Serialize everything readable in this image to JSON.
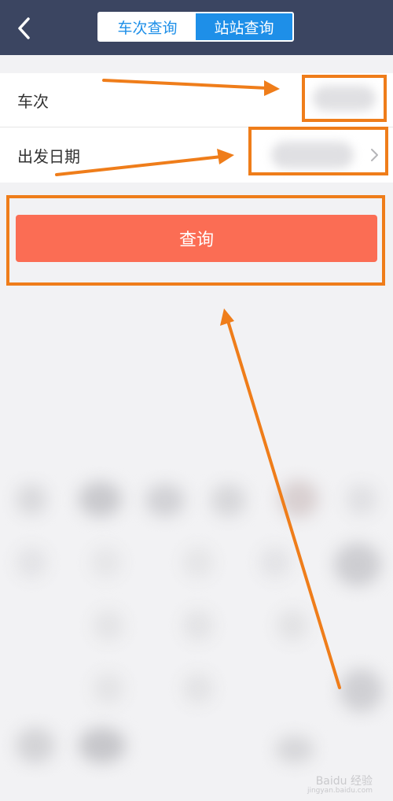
{
  "header": {
    "tabs": [
      {
        "label": "车次查询",
        "active": false
      },
      {
        "label": "站站查询",
        "active": true
      }
    ]
  },
  "form": {
    "train_label": "车次",
    "date_label": "出发日期"
  },
  "query_button": "查询",
  "watermark": {
    "brand": "Baidu 经验",
    "url": "jingyan.baidu.com"
  },
  "colors": {
    "topbar": "#3b4561",
    "tab_accent": "#1e8fe8",
    "button": "#fb6d54",
    "annotation": "#ef7d1a"
  }
}
